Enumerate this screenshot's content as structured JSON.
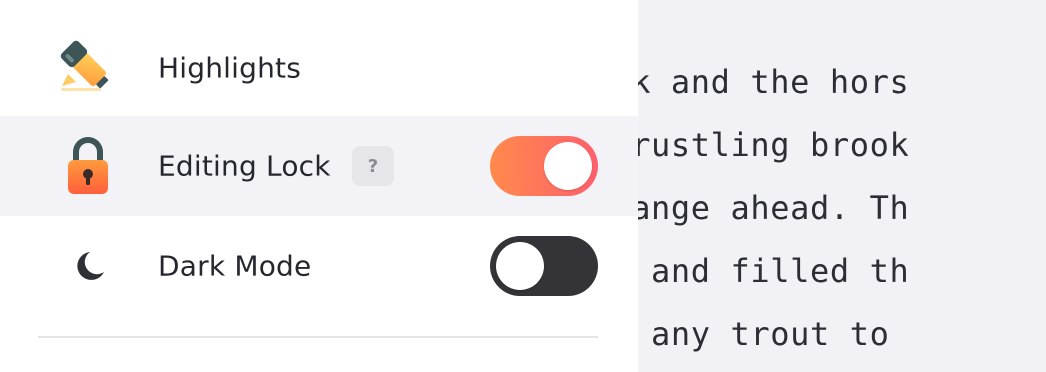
{
  "editor": {
    "lines": [
      "as dark and the hors",
      " by a rustling brook",
      "tain range ahead. Th",
      " water and filled th",
      "e were any trout to "
    ]
  },
  "menu": {
    "items": [
      {
        "label": "Highlights",
        "icon": "highlighter-icon"
      },
      {
        "label": "Editing Lock",
        "icon": "lock-icon",
        "help": "?",
        "toggle": true
      },
      {
        "label": "Dark Mode",
        "icon": "moon-icon",
        "toggle": false
      }
    ]
  },
  "colors": {
    "accent_start": "#ff8a4c",
    "accent_end": "#ff5f6d",
    "toggle_off": "#333338",
    "active_row": "#f3f3f7",
    "editor_bg": "#f1f1f6"
  }
}
